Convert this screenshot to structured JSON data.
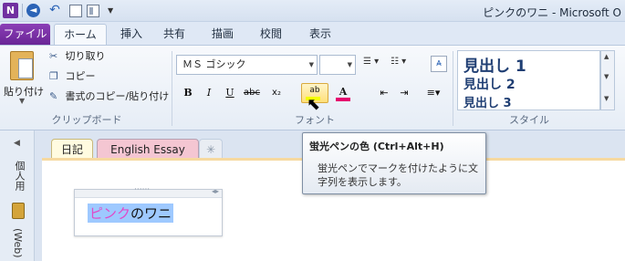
{
  "app": {
    "icon_letter": "N",
    "window_title": "ピンクのワニ - Microsoft O"
  },
  "quick_access": {
    "back_glyph": "◄",
    "undo_glyph": "↶",
    "more_glyph": "▼"
  },
  "ribbon_tabs": [
    {
      "label": "ファイル"
    },
    {
      "label": "ホーム"
    },
    {
      "label": "挿入"
    },
    {
      "label": "共有"
    },
    {
      "label": "描画"
    },
    {
      "label": "校閲"
    },
    {
      "label": "表示"
    }
  ],
  "clipboard": {
    "paste_label": "貼り付け",
    "cut_label": "切り取り",
    "copy_label": "コピー",
    "format_copy_label": "書式のコピー/貼り付け",
    "group_label": "クリップボード"
  },
  "font": {
    "font_name": "ＭＳ ゴシック",
    "font_size": "",
    "bold": "B",
    "italic": "I",
    "underline": "U",
    "strike": "abc",
    "subscript": "x₂",
    "highlight": "ab",
    "font_color": "A",
    "group_label": "フォント"
  },
  "styles": {
    "items": [
      "見出し 1",
      "見出し 2",
      "見出し 3"
    ],
    "group_label": "スタイル"
  },
  "notebook": {
    "name": "個人用",
    "web_label": "(Web)",
    "sections": [
      "日記",
      "English Essay"
    ]
  },
  "note": {
    "text_pink": "ピンク",
    "text_black": "のワニ"
  },
  "tooltip": {
    "title": "蛍光ペンの色 (Ctrl+Alt+H)",
    "body": "蛍光ペンでマークを付けたように文字列を表示します。"
  },
  "colors": {
    "file_tab": "#7030a0",
    "highlight_yellow": "#f4ff00",
    "font_color_bar": "#e6006e",
    "section_pink": "#f4c6d2"
  }
}
